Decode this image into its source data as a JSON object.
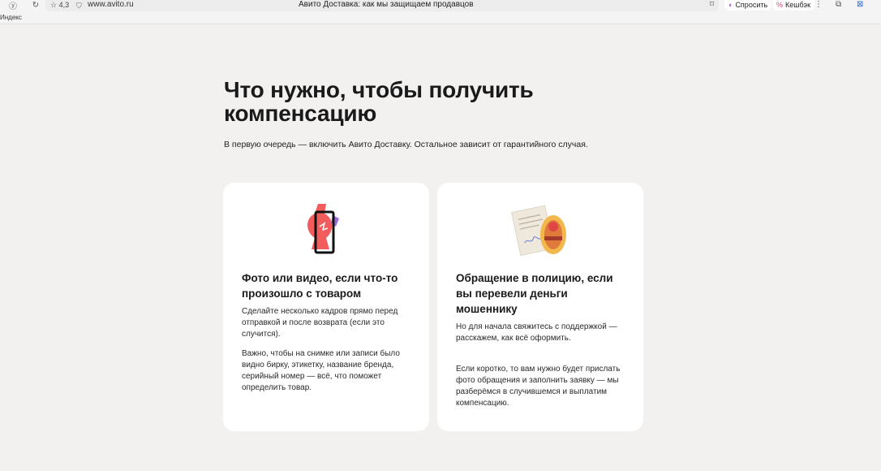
{
  "browser": {
    "rating": "4,3",
    "url": "www.avito.ru",
    "tab_title": "Авито Доставка: как мы защищаем продавцов",
    "ask_label": "Спросить",
    "cashback_label": "Кешбэк",
    "bookmark_label": "Индекс"
  },
  "page": {
    "heading": "Что нужно, чтобы получить компенсацию",
    "lead": "В первую очередь — включить Авито Доставку. Остальное зависит от гарантийного случая."
  },
  "cards": [
    {
      "title": "Фото или видео, если что-то произошло с товаром",
      "paragraphs": [
        "Сделайте несколько кадров прямо перед отправкой и после возврата (если это случится).",
        "Важно, чтобы на снимке или записи было видно бирку, этикетку, название бренда, серийный номер — всё, что поможет определить товар."
      ]
    },
    {
      "title": "Обращение в полицию, если вы перевели деньги мошеннику",
      "paragraphs": [
        "Но для начала свяжитесь с поддержкой — расскажем, как всё оформить.",
        "Если коротко, то вам нужно будет прислать фото обращения и заполнить заявку — мы разберёмся в случившемся и выплатим компенсацию."
      ]
    }
  ],
  "icons": {
    "card1": "phone-vase-icon",
    "card2": "police-document-icon"
  },
  "colors": {
    "background": "#f2f1f0",
    "card": "#ffffff",
    "accent_red": "#f25c5c",
    "accent_purple": "#9a6bd6",
    "accent_yellow": "#f2b84b"
  }
}
